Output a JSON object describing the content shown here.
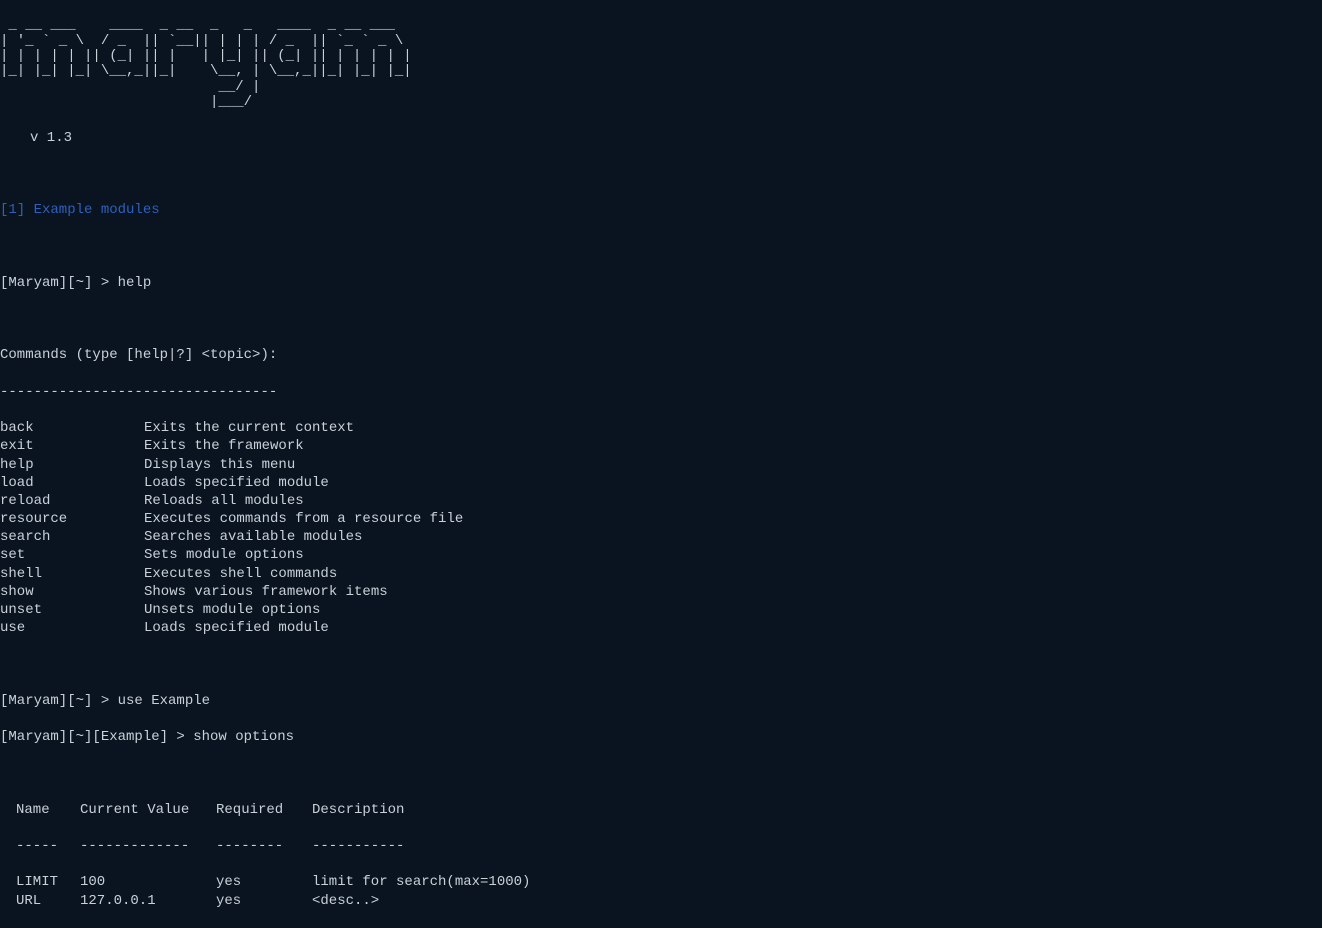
{
  "ascii_art": " _ __ ___    ____  _ __  _   _   ____  _ __ ___\n| '_ ` _ \\  / _  || `__|| | | | / _  || `_ ` _ \\\n| | | | | || (_| || |   | |_| || (_| || | | | | |\n|_| |_| |_| \\__,_||_|    \\__, | \\__,_||_| |_| |_|\n                          __/ |\n                         |___/",
  "version": "v 1.3",
  "module_line": "[1] Example modules",
  "prompt1": "[Maryam][~] > help",
  "help_header": "Commands (type [help|?] <topic>):",
  "help_divider": "---------------------------------",
  "commands": [
    {
      "name": "back",
      "desc": "Exits the current context"
    },
    {
      "name": "exit",
      "desc": "Exits the framework"
    },
    {
      "name": "help",
      "desc": "Displays this menu"
    },
    {
      "name": "load",
      "desc": "Loads specified module"
    },
    {
      "name": "reload",
      "desc": "Reloads all modules"
    },
    {
      "name": "resource",
      "desc": "Executes commands from a resource file"
    },
    {
      "name": "search",
      "desc": "Searches available modules"
    },
    {
      "name": "set",
      "desc": "Sets module options"
    },
    {
      "name": "shell",
      "desc": "Executes shell commands"
    },
    {
      "name": "show",
      "desc": "Shows various framework items"
    },
    {
      "name": "unset",
      "desc": "Unsets module options"
    },
    {
      "name": "use",
      "desc": "Loads specified module"
    }
  ],
  "prompt2": "[Maryam][~] > use Example",
  "prompt3": "[Maryam][~][Example] > show options",
  "options_header": {
    "name": "Name",
    "value": "Current Value",
    "required": "Required",
    "desc": "Description"
  },
  "options_divider": {
    "name": "-----",
    "value": "-------------",
    "required": "--------",
    "desc": "-----------"
  },
  "options": [
    {
      "name": "LIMIT",
      "value": "100",
      "required": "yes",
      "desc": "limit for search(max=1000)"
    },
    {
      "name": "URL",
      "value": "127.0.0.1",
      "required": "yes",
      "desc": "<desc..>"
    }
  ]
}
